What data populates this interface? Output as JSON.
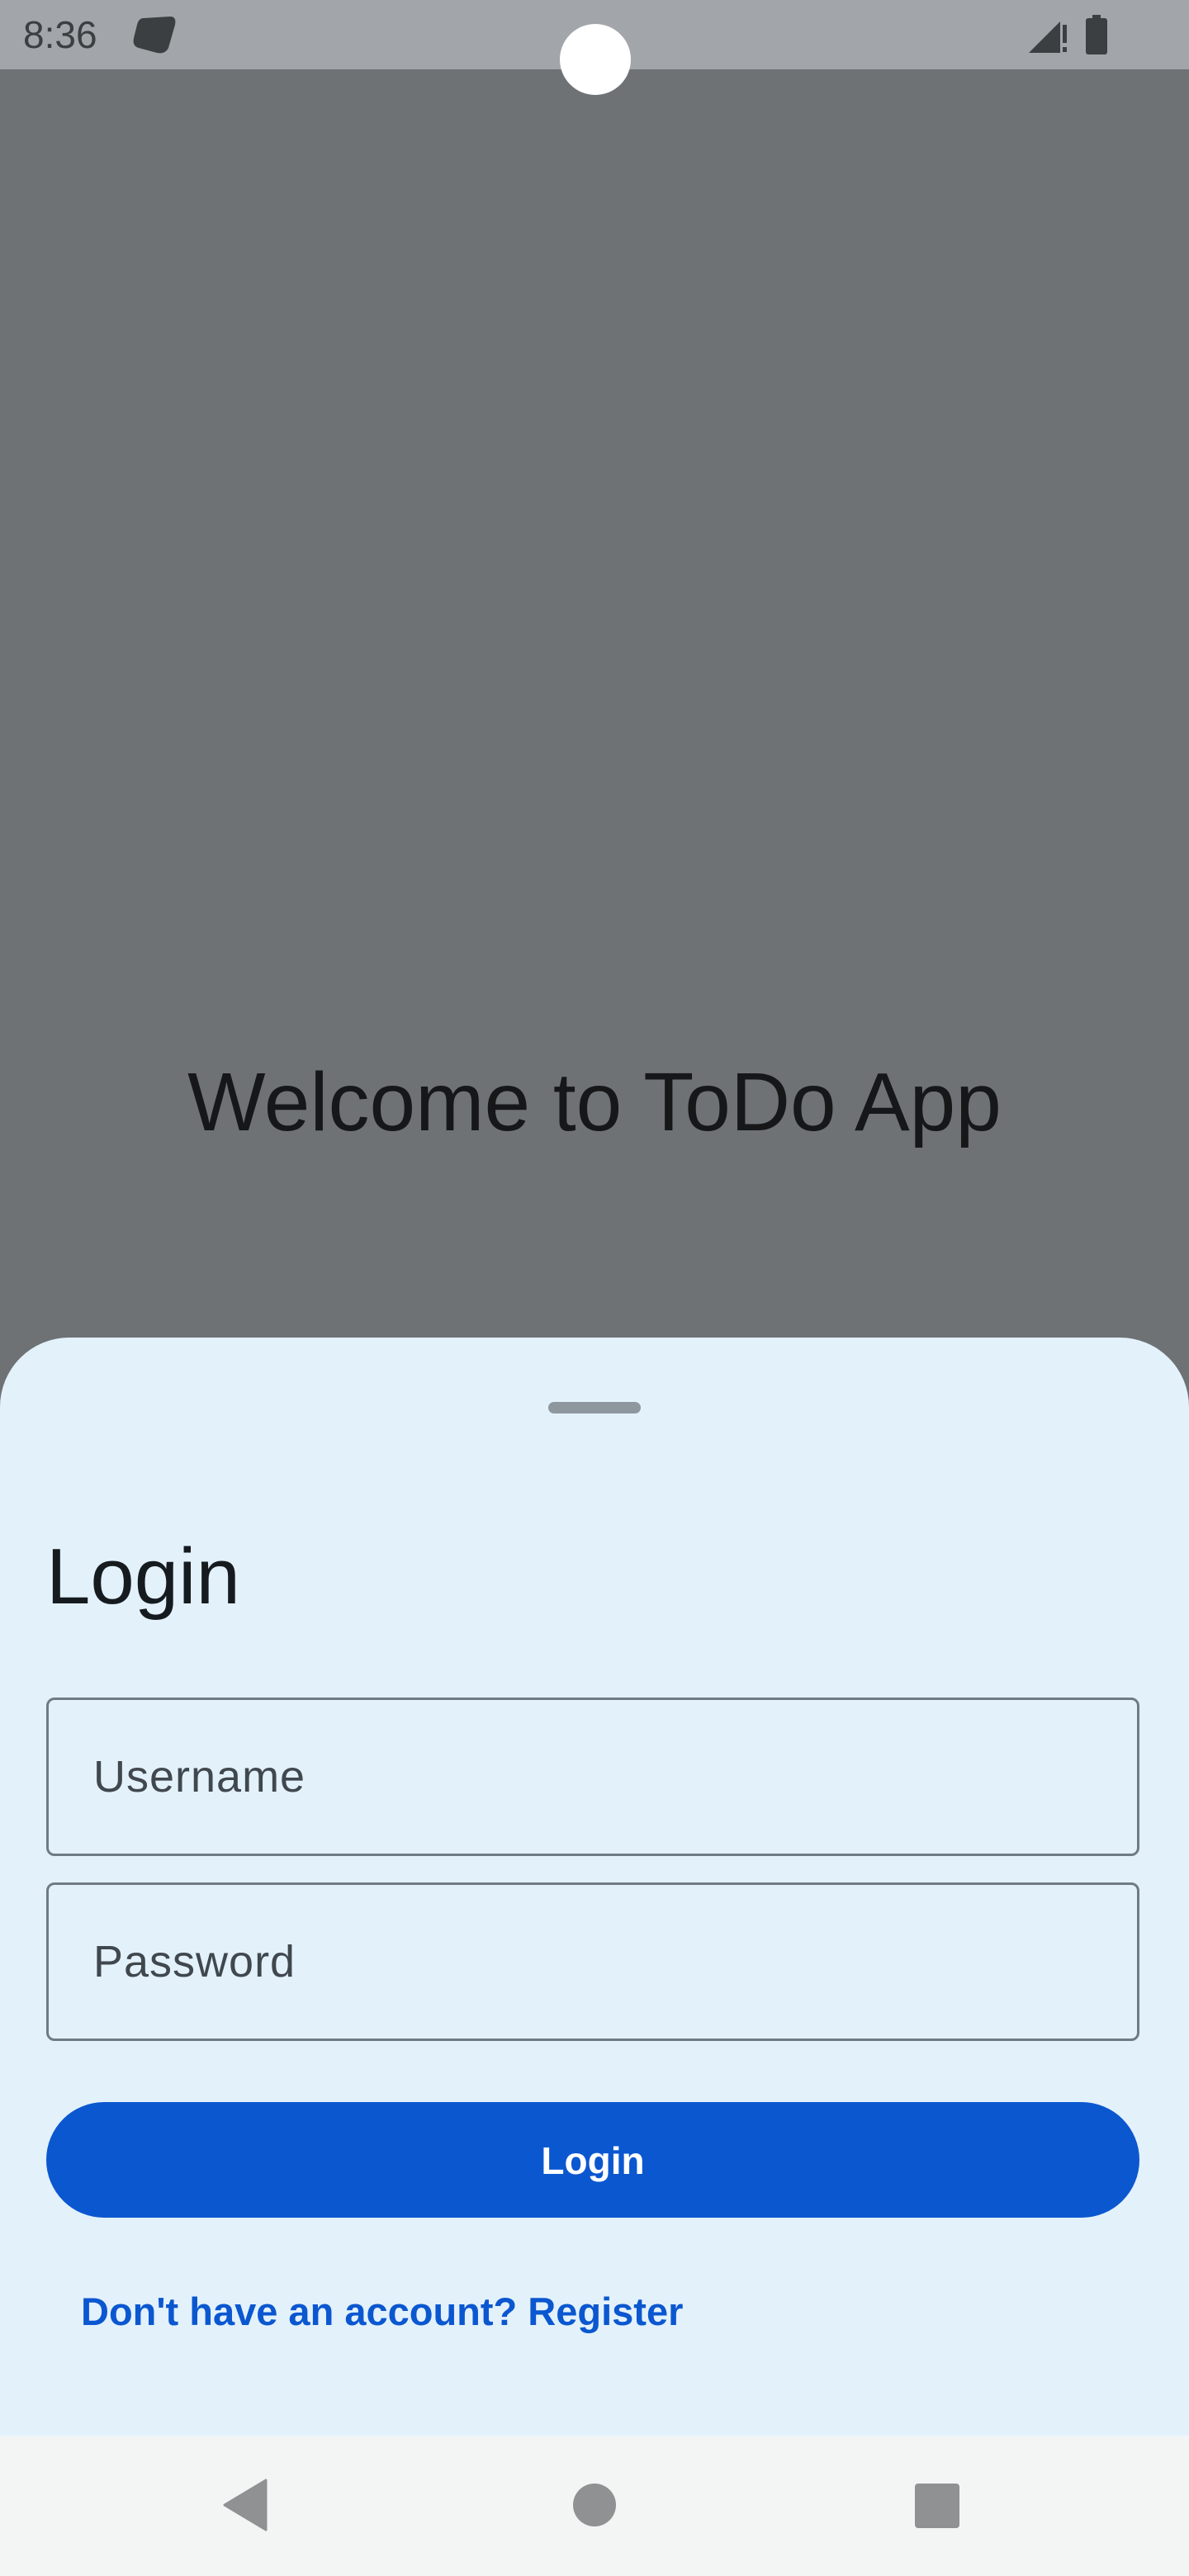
{
  "status_bar": {
    "time": "8:36",
    "icons": [
      "app-notification-icon",
      "signal-icon",
      "battery-icon"
    ]
  },
  "background": {
    "welcome_text": "Welcome to ToDo App"
  },
  "login_sheet": {
    "title": "Login",
    "username_placeholder": "Username",
    "username_value": "",
    "password_placeholder": "Password",
    "password_value": "",
    "login_button_label": "Login",
    "register_link_text": "Don't have an account? Register"
  },
  "navigation_bar": {
    "icons": [
      "back-icon",
      "home-icon",
      "recents-icon"
    ]
  },
  "colors": {
    "scrim": "#6e7275",
    "sheet_background": "#e3f1fb",
    "primary": "#0b57d0",
    "status_bar": "#a2a6aa",
    "nav_bar": "#f3f5f5"
  }
}
